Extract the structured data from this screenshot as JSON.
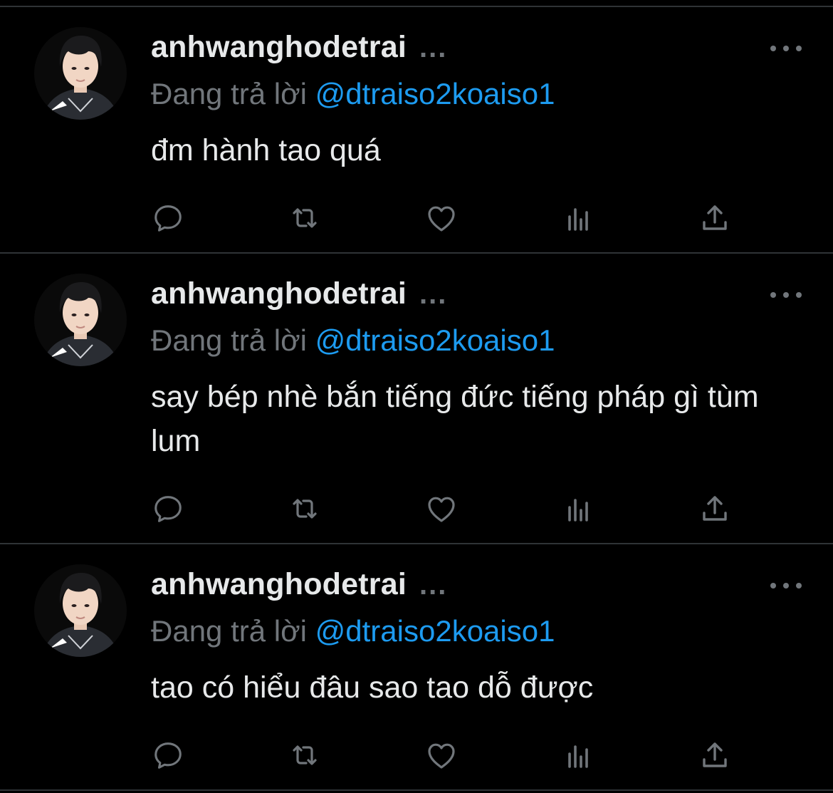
{
  "colors": {
    "background": "#000000",
    "divider": "#2f3336",
    "text_primary": "#e7e9ea",
    "text_secondary": "#71767b",
    "accent": "#1d9bf0"
  },
  "tweets": [
    {
      "username": "anhwanghodetrai",
      "ellipsis": "...",
      "reply_label": "Đang trả lời",
      "reply_handle": "@dtraiso2koaiso1",
      "text": "đm hành tao quá",
      "avatar_icon": "avatar-photo",
      "more_icon": "more-horizontal-icon",
      "actions": [
        "reply-icon",
        "retweet-icon",
        "like-icon",
        "analytics-icon",
        "share-icon"
      ]
    },
    {
      "username": "anhwanghodetrai",
      "ellipsis": "...",
      "reply_label": "Đang trả lời",
      "reply_handle": "@dtraiso2koaiso1",
      "text": "say bép nhè bắn tiếng đức tiếng pháp gì tùm lum",
      "avatar_icon": "avatar-photo",
      "more_icon": "more-horizontal-icon",
      "actions": [
        "reply-icon",
        "retweet-icon",
        "like-icon",
        "analytics-icon",
        "share-icon"
      ]
    },
    {
      "username": "anhwanghodetrai",
      "ellipsis": "...",
      "reply_label": "Đang trả lời",
      "reply_handle": "@dtraiso2koaiso1",
      "text": "tao có hiểu đâu sao tao dỗ được",
      "avatar_icon": "avatar-photo",
      "more_icon": "more-horizontal-icon",
      "actions": [
        "reply-icon",
        "retweet-icon",
        "like-icon",
        "analytics-icon",
        "share-icon"
      ]
    }
  ]
}
